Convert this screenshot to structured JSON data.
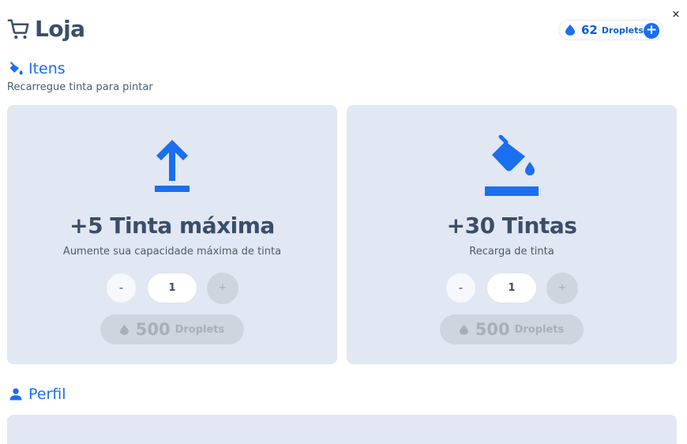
{
  "header": {
    "title": "Loja",
    "close_label": "×"
  },
  "balance": {
    "amount": "62",
    "unit": "Droplets",
    "add_label": "+"
  },
  "items_section": {
    "title": "Itens",
    "subtitle": "Recarregue tinta para pintar"
  },
  "products": [
    {
      "title": "+5 Tinta máxima",
      "description": "Aumente sua capacidade máxima de tinta",
      "icon": "upload-arrow-icon",
      "minus_label": "-",
      "quantity": "1",
      "plus_label": "+",
      "price": "500",
      "price_unit": "Droplets"
    },
    {
      "title": "+30 Tintas",
      "description": "Recarga de tinta",
      "icon": "paint-bucket-icon",
      "minus_label": "-",
      "quantity": "1",
      "plus_label": "+",
      "price": "500",
      "price_unit": "Droplets"
    }
  ],
  "profile_section": {
    "title": "Perfil"
  },
  "colors": {
    "accent": "#1a6ef0",
    "text": "#394e6a",
    "card_bg": "#e1e7f3",
    "disabled": "#cfd5df"
  }
}
